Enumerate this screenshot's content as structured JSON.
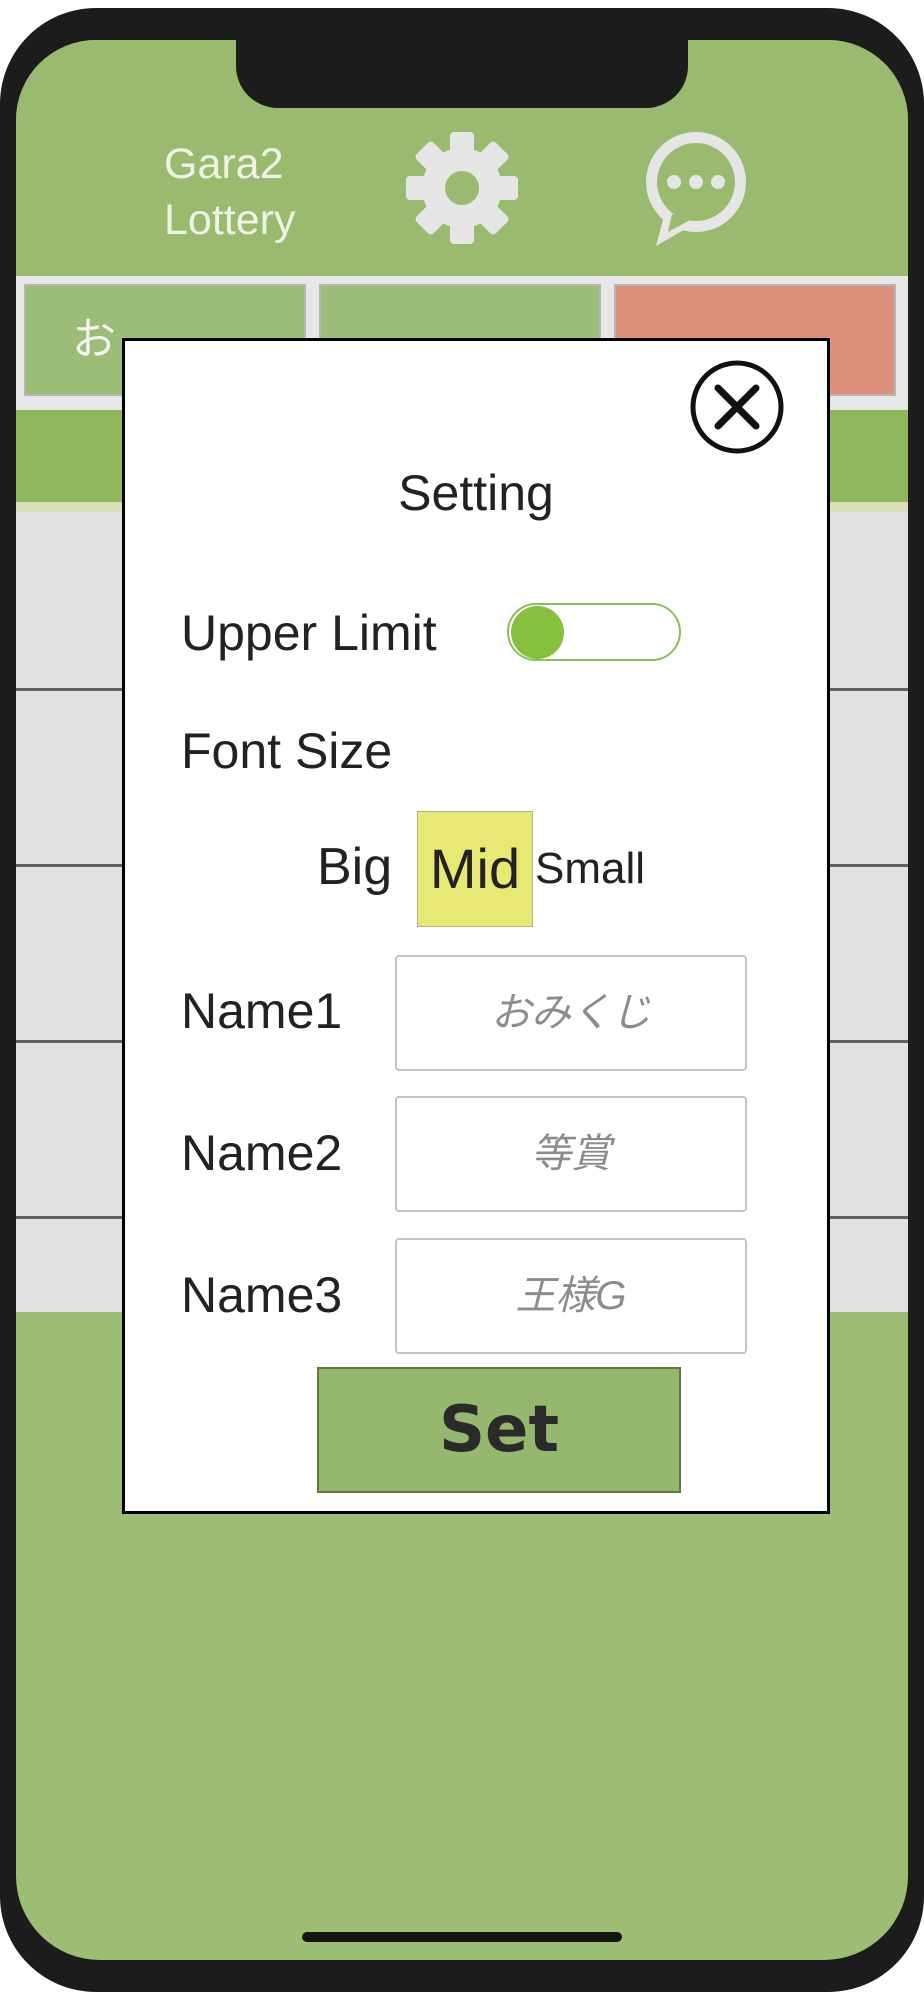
{
  "app": {
    "title_line1": "Gara2",
    "title_line2": "Lottery",
    "settings_icon": "gear-icon",
    "chat_icon": "chat-bubble-icon"
  },
  "tabs": [
    {
      "label": "お"
    },
    {
      "label": ""
    },
    {
      "label": ""
    }
  ],
  "dialog": {
    "title": "Setting",
    "close_icon": "close-circle-icon",
    "upper_limit_label": "Upper Limit",
    "upper_limit_on": false,
    "font_size_label": "Font Size",
    "font_options": [
      "Big",
      "Mid",
      "Small"
    ],
    "font_selected": "Mid",
    "name1_label": "Name1",
    "name1_placeholder": "おみくじ",
    "name2_label": "Name2",
    "name2_placeholder": "等賞",
    "name3_label": "Name3",
    "name3_placeholder": "王様G",
    "set_label": "Set"
  },
  "colors": {
    "background_green": "#9dbd74",
    "toggle_accent": "#85c03e",
    "selected_option": "#e8e875",
    "set_button": "#95b86e",
    "tab_red": "#de907d"
  }
}
